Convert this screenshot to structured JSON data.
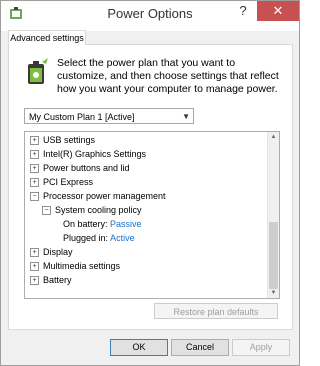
{
  "window": {
    "title": "Power Options",
    "help_label": "?",
    "close_label": "✕"
  },
  "tab": {
    "label": "Advanced settings"
  },
  "intro_text": "Select the power plan that you want to customize, and then choose settings that reflect how you want your computer to manage power.",
  "plan_select": {
    "value": "My Custom Plan 1 [Active]",
    "chevron": "▼"
  },
  "tree": {
    "items": [
      {
        "expander": "+",
        "label": "USB settings"
      },
      {
        "expander": "+",
        "label": "Intel(R) Graphics Settings"
      },
      {
        "expander": "+",
        "label": "Power buttons and lid"
      },
      {
        "expander": "+",
        "label": "PCI Express"
      },
      {
        "expander": "−",
        "label": "Processor power management"
      },
      {
        "expander": "−",
        "label": "System cooling policy"
      },
      {
        "label": "On battery:",
        "value": "Passive"
      },
      {
        "label": "Plugged in:",
        "value": "Active"
      },
      {
        "expander": "+",
        "label": "Display"
      },
      {
        "expander": "+",
        "label": "Multimedia settings"
      },
      {
        "expander": "+",
        "label": "Battery"
      }
    ]
  },
  "scrollbar": {
    "up": "▲",
    "down": "▼"
  },
  "restore_button": {
    "label": "Restore plan defaults"
  },
  "footer": {
    "ok_label": "OK",
    "cancel_label": "Cancel",
    "apply_label": "Apply"
  },
  "colors": {
    "accent_value": "#1a73c9",
    "close_bg": "#c75050"
  }
}
